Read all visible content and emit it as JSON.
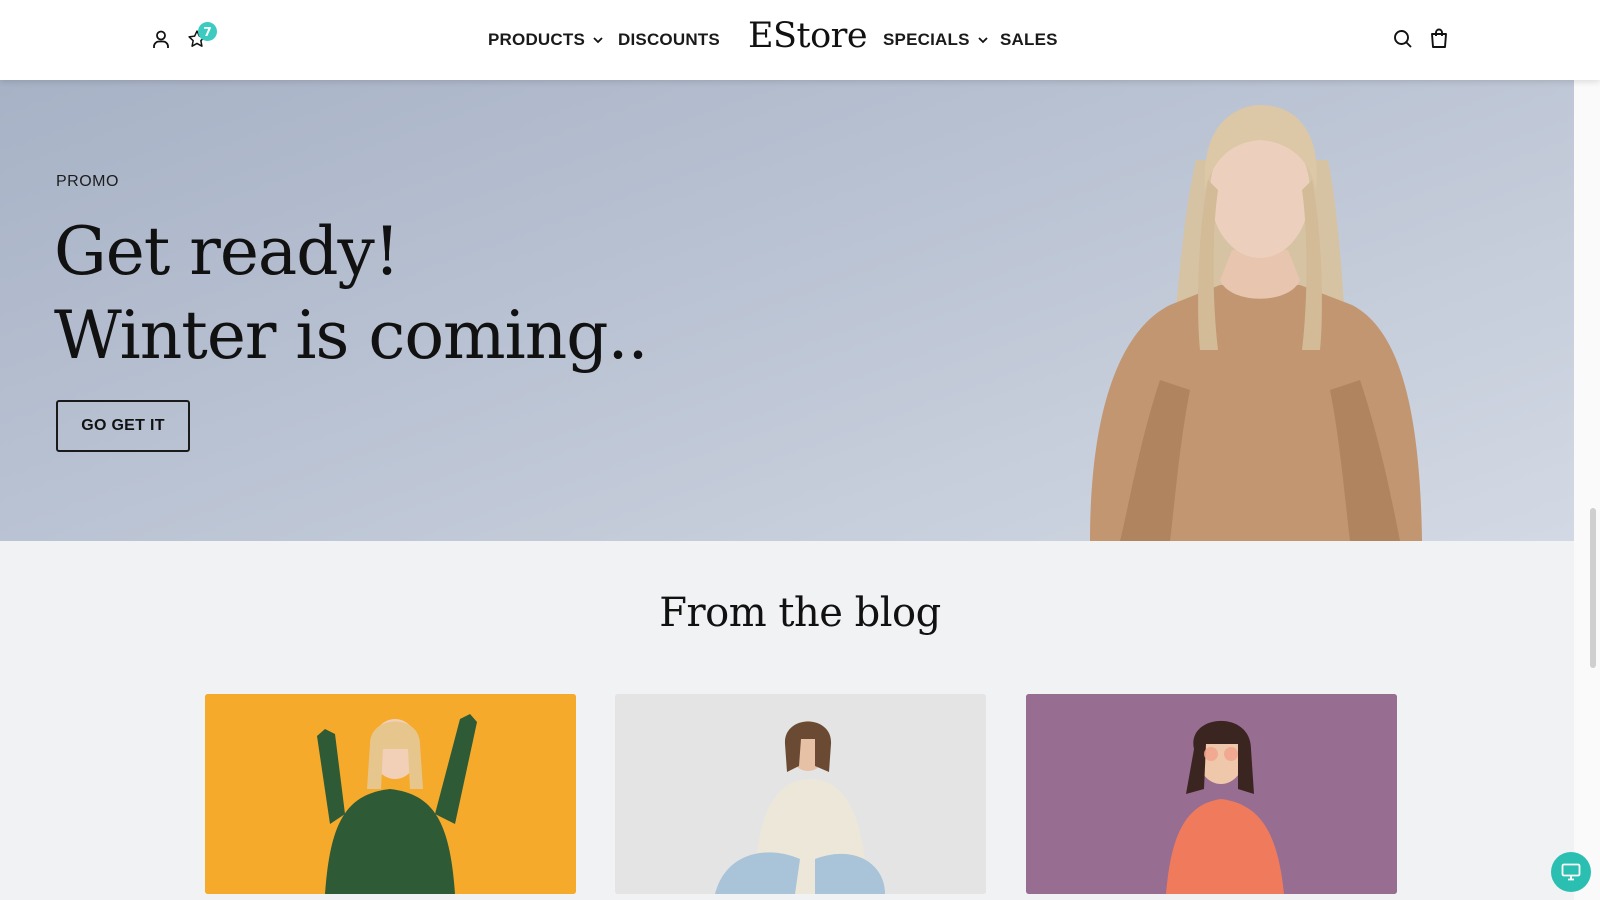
{
  "header": {
    "wishlist_count": "7",
    "nav_left": [
      {
        "label": "PRODUCTS",
        "has_dropdown": true
      },
      {
        "label": "DISCOUNTS",
        "has_dropdown": false
      }
    ],
    "logo": "EStore",
    "nav_right": [
      {
        "label": "SPECIALS",
        "has_dropdown": true
      },
      {
        "label": "SALES",
        "has_dropdown": false
      }
    ],
    "icons": [
      "user-icon",
      "star-icon",
      "search-icon",
      "shopping-bag-icon"
    ]
  },
  "hero": {
    "label": "PROMO",
    "title_line1": "Get ready!",
    "title_line2": "Winter is coming..",
    "cta": "GO GET IT"
  },
  "blog": {
    "heading": "From the blog",
    "cards": [
      {
        "image": "woman-green-sweater-orange-background"
      },
      {
        "image": "woman-cream-hoodie-sitting"
      },
      {
        "image": "woman-coral-sweater-purple-background"
      }
    ]
  },
  "colors": {
    "accent": "#3ccbc0",
    "hero_bg": "#bac3d3",
    "blog_bg": "#f1f2f4"
  }
}
